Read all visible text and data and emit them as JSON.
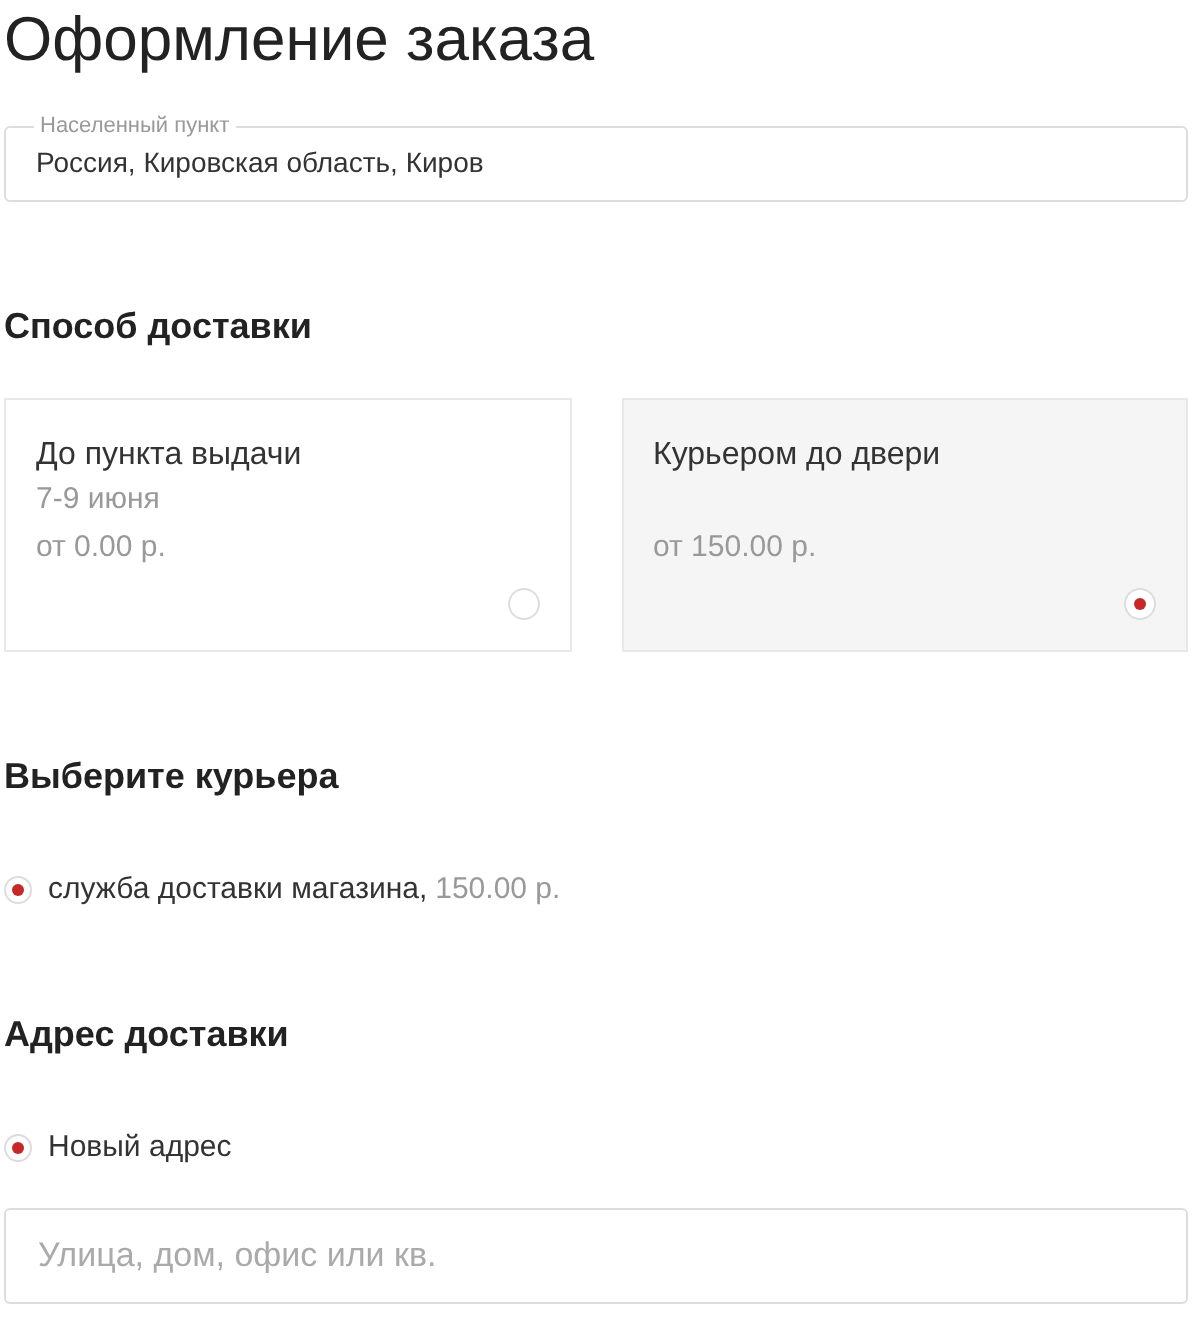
{
  "title": "Оформление заказа",
  "locality": {
    "label": "Населенный пункт",
    "value": "Россия, Кировская область, Киров"
  },
  "delivery": {
    "heading": "Способ доставки",
    "options": [
      {
        "name": "До пункта выдачи",
        "date": "7-9 июня",
        "price": "от 0.00 р.",
        "selected": false
      },
      {
        "name": "Курьером до двери",
        "price": "от 150.00 р.",
        "selected": true
      }
    ]
  },
  "courier": {
    "heading": "Выберите курьера",
    "options": [
      {
        "name": "служба доставки магазина,",
        "price": "150.00 р.",
        "selected": true
      }
    ]
  },
  "address": {
    "heading": "Адрес доставки",
    "options": [
      {
        "name": "Новый адрес",
        "selected": true
      }
    ],
    "street": {
      "placeholder": "Улица, дом, офис или кв."
    }
  }
}
